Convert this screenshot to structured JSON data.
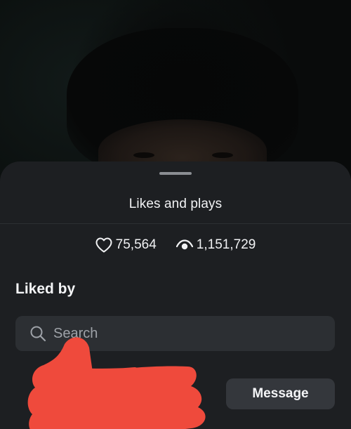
{
  "sheet": {
    "title": "Likes and plays"
  },
  "stats": {
    "likes": "75,564",
    "plays": "1,151,729",
    "likes_icon": "heart-icon",
    "plays_icon": "eye-icon"
  },
  "liked_by": {
    "heading": "Liked by",
    "search_placeholder": "Search",
    "search_icon": "search-icon"
  },
  "users": [
    {
      "action_label": "Message",
      "name_redacted": true
    }
  ],
  "colors": {
    "sheet_bg": "#1d1f22",
    "field_bg": "#2c2f33",
    "button_bg": "#34373c",
    "redaction": "#ef4a3c",
    "text": "#f1f2f4"
  }
}
